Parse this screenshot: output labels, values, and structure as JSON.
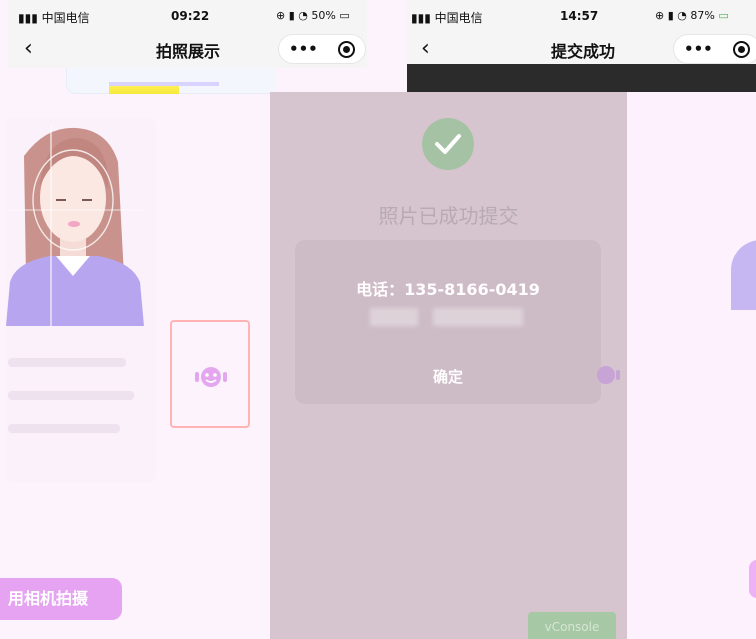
{
  "left_phone": {
    "status": {
      "carrier": "中国电信",
      "time": "09:22",
      "right": "50%"
    },
    "nav": {
      "title": "拍照展示",
      "more_label": "•••"
    },
    "camera_button_label": "用相机拍摄"
  },
  "mid_phone": {
    "status": {
      "carrier": "中国电信",
      "time": "14:57",
      "right": "87%"
    },
    "nav": {
      "title": "提交成功",
      "more_label": "•••"
    },
    "success_title": "照片已成功提交",
    "dialog": {
      "phone": "电话：135-8166-0419",
      "ok_label": "确定"
    },
    "vconsole_label": "vConsole"
  },
  "colors": {
    "accent_pink": "#e5a3f2",
    "success_green": "#a6c2a4",
    "overlay": "#d6c5cf",
    "page_bg": "#fdf3fd"
  },
  "icons": [
    "back-icon",
    "more-icon",
    "close-icon",
    "face-scan-icon",
    "check-icon"
  ]
}
